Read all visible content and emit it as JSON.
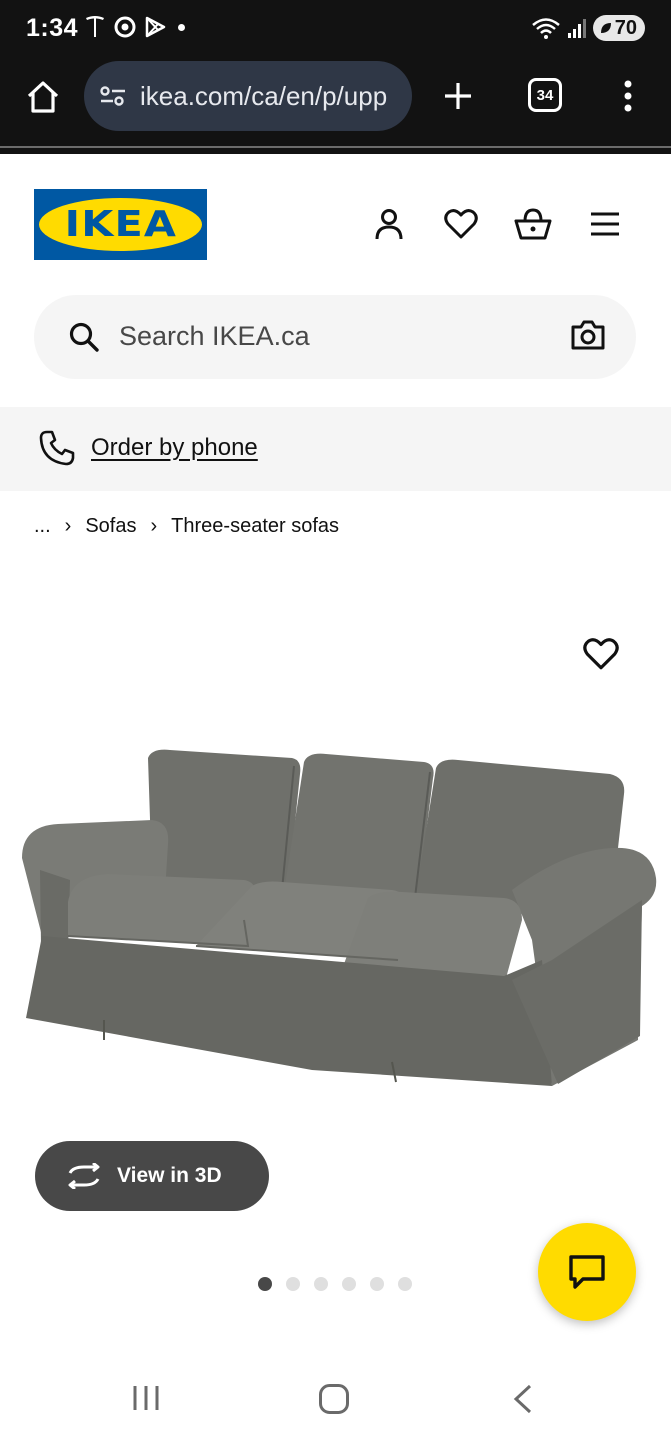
{
  "status_bar": {
    "time": "1:34",
    "battery": "70"
  },
  "browser": {
    "url": "ikea.com/ca/en/p/upp",
    "tab_count": "34"
  },
  "header": {
    "logo_text": "IKEA",
    "brand_colors": {
      "blue": "#0058a3",
      "yellow": "#ffdb00"
    },
    "icons": [
      "account-icon",
      "wishlist-heart-icon",
      "shopping-basket-icon",
      "hamburger-menu-icon"
    ]
  },
  "search": {
    "placeholder": "Search IKEA.ca"
  },
  "contact": {
    "order_by_phone": "Order by phone"
  },
  "breadcrumb": {
    "ellipsis": "...",
    "items": [
      "Sofas",
      "Three-seater sofas"
    ]
  },
  "media": {
    "view_3d_label": "View in 3D",
    "image_count": 6,
    "active_image": 1
  }
}
